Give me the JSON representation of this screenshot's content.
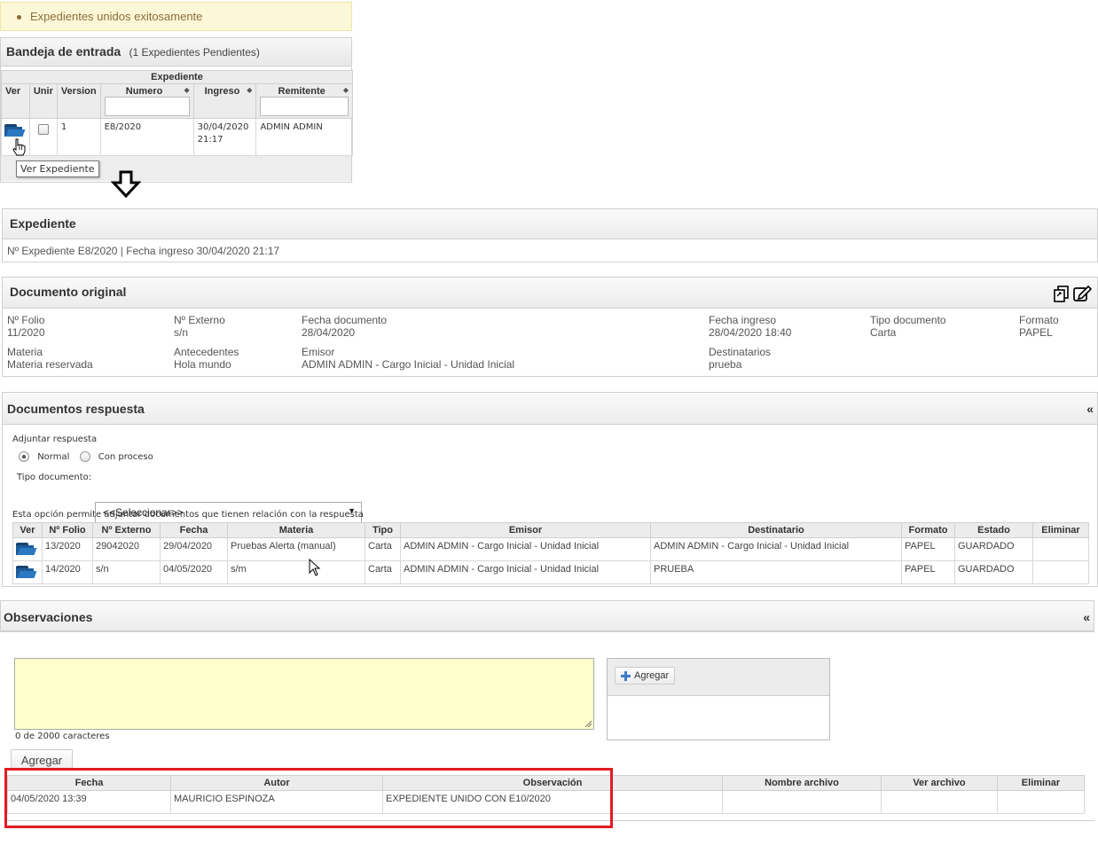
{
  "message": {
    "text": "Expedientes unidos exitosamente"
  },
  "inbox": {
    "title": "Bandeja de entrada",
    "subtitle": "(1 Expedientes Pendientes)",
    "group_header": "Expediente",
    "columns": [
      "Ver",
      "Unir",
      "Version",
      "Numero",
      "Ingreso",
      "Remitente"
    ],
    "row": {
      "version": "1",
      "numero": "E8/2020",
      "ingreso_date": "30/04/2020",
      "ingreso_time": "21:17",
      "remitente": "ADMIN ADMIN"
    },
    "tooltip": "Ver Expediente"
  },
  "expediente": {
    "title": "Expediente",
    "info": "Nº Expediente E8/2020 | Fecha ingreso 30/04/2020 21:17"
  },
  "documento_original": {
    "title": "Documento original",
    "fields": {
      "folio_label": "Nº Folio",
      "folio": "11/2020",
      "externo_label": "Nº Externo",
      "externo": "s/n",
      "fecha_doc_label": "Fecha documento",
      "fecha_doc": "28/04/2020",
      "fecha_ingreso_label": "Fecha ingreso",
      "fecha_ingreso": "28/04/2020 18:40",
      "tipo_label": "Tipo documento",
      "tipo": "Carta",
      "formato_label": "Formato",
      "formato": "PAPEL",
      "materia_label": "Materia",
      "materia": "Materia reservada",
      "antecedentes_label": "Antecedentes",
      "antecedentes": "Hola mundo",
      "emisor_label": "Emisor",
      "emisor": "ADMIN ADMIN - Cargo Inicial - Unidad Inicial",
      "destinatarios_label": "Destinatarios",
      "destinatarios": "prueba"
    }
  },
  "respuesta": {
    "title": "Documentos respuesta",
    "collapse": "«",
    "adjuntar_label": "Adjuntar respuesta",
    "radio_normal": "Normal",
    "radio_proceso": "Con proceso",
    "tipo_label": "Tipo documento:",
    "tipo_value": "<<Seleccionar>>",
    "note": "Esta opción permite adjuntar documentos que tienen relación con la respuesta",
    "columns": [
      "Ver",
      "Nº Folio",
      "Nº Externo",
      "Fecha",
      "Materia",
      "Tipo",
      "Emisor",
      "Destinatario",
      "Formato",
      "Estado",
      "Eliminar"
    ],
    "rows": [
      {
        "folio": "13/2020",
        "externo": "29042020",
        "fecha": "29/04/2020",
        "materia": "Pruebas Alerta (manual)",
        "tipo": "Carta",
        "emisor": "ADMIN ADMIN - Cargo Inicial - Unidad Inicial",
        "destinatario": "ADMIN ADMIN - Cargo Inicial - Unidad Inicial",
        "formato": "PAPEL",
        "estado": "GUARDADO"
      },
      {
        "folio": "14/2020",
        "externo": "s/n",
        "fecha": "04/05/2020",
        "materia": "s/m",
        "tipo": "Carta",
        "emisor": "ADMIN ADMIN - Cargo Inicial - Unidad Inicial",
        "destinatario": "PRUEBA",
        "formato": "PAPEL",
        "estado": "GUARDADO"
      }
    ]
  },
  "observaciones": {
    "title": "Observaciones",
    "collapse": "«",
    "counter": "0 de 2000 caracteres",
    "add_label": "Agregar",
    "attach_label": "Agregar",
    "columns": [
      "Fecha",
      "Autor",
      "Observación",
      "Nombre archivo",
      "Ver archivo",
      "Eliminar"
    ],
    "rows": [
      {
        "fecha": "04/05/2020 13:39",
        "autor": "MAURICIO ESPINOZA",
        "observacion": "EXPEDIENTE UNIDO CON E10/2020",
        "archivo": "",
        "ver": "",
        "eliminar": ""
      }
    ]
  },
  "colors": {
    "highlight": "#e31b23",
    "message_bg": "#fcf7d6",
    "folder": "#1d5b99"
  }
}
